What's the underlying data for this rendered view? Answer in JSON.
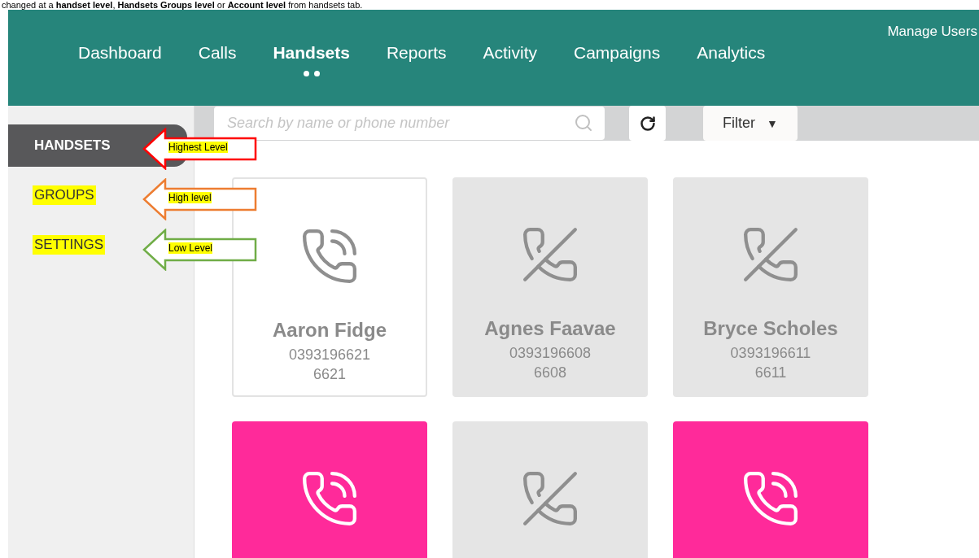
{
  "document_text": "changed at a **handset level**, **Handsets Groups level** or **Account level** from handsets tab.",
  "header": {
    "nav": [
      {
        "label": "Dashboard",
        "selected": false
      },
      {
        "label": "Calls",
        "selected": false
      },
      {
        "label": "Handsets",
        "selected": true
      },
      {
        "label": "Reports",
        "selected": false
      },
      {
        "label": "Activity",
        "selected": false
      },
      {
        "label": "Campaigns",
        "selected": false
      },
      {
        "label": "Analytics",
        "selected": false
      }
    ],
    "manage_users": "Manage Users"
  },
  "sidebar": {
    "items": [
      {
        "label": "HANDSETS",
        "selected": true,
        "highlighted": false
      },
      {
        "label": "GROUPS",
        "selected": false,
        "highlighted": true
      },
      {
        "label": "SETTINGS",
        "selected": false,
        "highlighted": true
      }
    ]
  },
  "annotations": [
    {
      "label": "Highest Level",
      "color": "#ff0000"
    },
    {
      "label": "High level",
      "color": "#ed7d31"
    },
    {
      "label": "Low Level",
      "color": "#70ad47"
    }
  ],
  "toolbar": {
    "search": {
      "placeholder": "Search by name or phone number"
    },
    "filter": {
      "label": "Filter",
      "caret": "▼"
    }
  },
  "handsets": [
    {
      "kind": "available",
      "name": "Aaron Fidge",
      "number": "0393196621",
      "extension": "6621"
    },
    {
      "kind": "offline",
      "name": "Agnes Faavae",
      "number": "0393196608",
      "extension": "6608"
    },
    {
      "kind": "offline",
      "name": "Bryce Scholes",
      "number": "0393196611",
      "extension": "6611"
    },
    {
      "kind": "busy"
    },
    {
      "kind": "offline"
    },
    {
      "kind": "busy"
    }
  ]
}
